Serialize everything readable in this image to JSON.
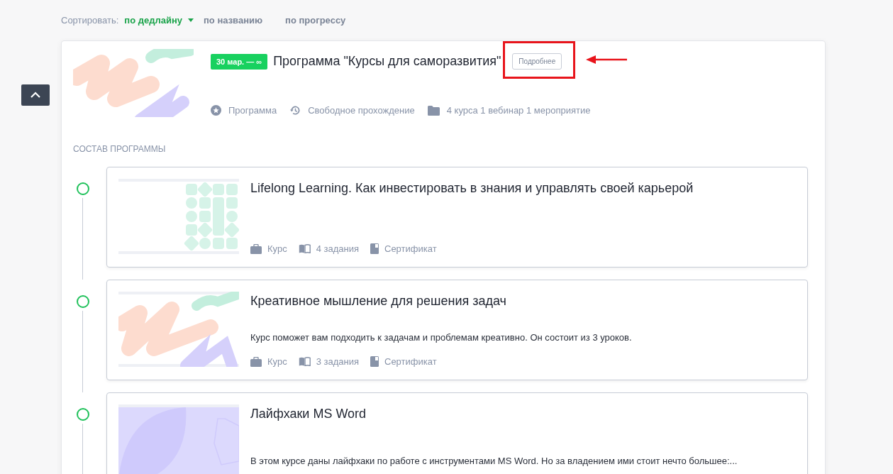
{
  "sort": {
    "label": "Сортировать:",
    "options": [
      {
        "label": "по дедлайну",
        "selected": true
      },
      {
        "label": "по названию",
        "selected": false
      },
      {
        "label": "по прогрессу",
        "selected": false
      }
    ]
  },
  "program": {
    "date_badge": "30 мар. — ∞",
    "title": "Программа \"Курсы для саморазвития\"",
    "details_button": "Подробнее",
    "highlighted": true,
    "meta": [
      {
        "kind": "star",
        "text": "Программа"
      },
      {
        "kind": "history",
        "text": "Свободное прохождение"
      },
      {
        "kind": "folder",
        "text": "4 курса 1 вебинар 1 мероприятие"
      }
    ],
    "section_title": "СОСТАВ ПРОГРАММЫ"
  },
  "courses": [
    {
      "kind": "tiles",
      "title": "Lifelong Learning. Как инвестировать в знания и управлять своей карьерой",
      "meta": [
        {
          "kind": "case",
          "text": "Курс"
        },
        {
          "kind": "book",
          "text": "4 задания"
        },
        {
          "kind": "cert",
          "text": "Сертификат"
        }
      ]
    },
    {
      "kind": "scribble",
      "title": "Креативное мышление для решения задач",
      "description": "Курс поможет вам подходить к задачам и проблемам креативно. Он состоит из 3 уроков.",
      "meta": [
        {
          "kind": "case",
          "text": "Курс"
        },
        {
          "kind": "book",
          "text": "3 задания"
        },
        {
          "kind": "cert",
          "text": "Сертификат"
        }
      ]
    },
    {
      "kind": "leaf",
      "title": "Лайфхаки MS Word",
      "description": "В этом курсе даны лайфхаки по работе с инструментами MS Word. Но за владением ими стоит нечто большее:..."
    }
  ]
}
